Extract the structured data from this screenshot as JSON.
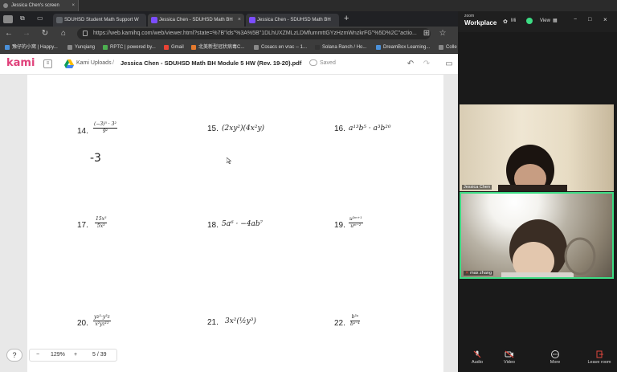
{
  "share_bar": {
    "title": "Jessica Chen's screen"
  },
  "browser": {
    "tabs": [
      {
        "label": "SDUHSD Student Math Support W"
      },
      {
        "label": "Jessica Chen - SDUHSD Math BH"
      },
      {
        "label": "Jessica Chen - SDUHSD Math BH"
      }
    ],
    "url": "https://web.kamihq.com/web/viewer.html?state=%7B\"ids\"%3A%5B\"1DLhUXZMLzLDMfummttGYzHzmWnzkrFG\"%5D%2C\"actio...",
    "bookmarks": [
      "豫仔的小窝 | Happy...",
      "Yunqiang",
      "RPTC | powered by...",
      "Gmail",
      "北美新型冠状病毒C...",
      "Cosacs en vrac -- 1...",
      "Solana Ranch / Ho...",
      "DreamBox Learning...",
      "Colle"
    ]
  },
  "kami": {
    "logo": "kami",
    "breadcrumb_root": "Kami Uploads",
    "breadcrumb_sep": "/",
    "filename": "Jessica Chen - SDUHSD Math BH Module 5 HW (Rev. 19-20).pdf",
    "saved_label": "Saved"
  },
  "document": {
    "handwritten": "-3",
    "problems": [
      {
        "num": "14.",
        "type": "frac",
        "n": "(−3)⁵ · 3²",
        "d": "9²"
      },
      {
        "num": "15.",
        "type": "expr",
        "text": "(2xy²)(4x²y)"
      },
      {
        "num": "16.",
        "type": "expr",
        "text": "a¹³b⁵ · a³b²⁰"
      },
      {
        "num": "17.",
        "type": "frac",
        "n": "15x⁵",
        "d": "5x³"
      },
      {
        "num": "18.",
        "type": "expr",
        "text": "5a⁶ · −4ab⁷"
      },
      {
        "num": "19.",
        "type": "frac",
        "n": "u²ᵐ⁺¹",
        "d": "uᵐ⁻²"
      },
      {
        "num": "20.",
        "type": "frac",
        "n": "yz²·y³z",
        "d": "x²yz¹²"
      },
      {
        "num": "21.",
        "type": "expr",
        "text": "3x²(½y³)"
      },
      {
        "num": "22.",
        "type": "frac",
        "n": "b³ᵃ",
        "d": "bᵃ⁻⁴"
      }
    ]
  },
  "viewer_controls": {
    "help": "?",
    "zoom_out": "−",
    "zoom_level": "129%",
    "zoom_in": "+",
    "page": "5 / 39"
  },
  "zoom_app": {
    "logo_small": "zoom",
    "logo_big": "Workplace",
    "header_items": [
      "Mi",
      "View"
    ],
    "participants": [
      {
        "name": "Jessica Chen"
      },
      {
        "name": "max zhang"
      }
    ],
    "footer": [
      {
        "label": "Audio"
      },
      {
        "label": "Video"
      },
      {
        "label": "More"
      },
      {
        "label": "Leave room"
      }
    ],
    "colors": {
      "active_speaker": "#3ddc84",
      "leave": "#e0463c",
      "kami_brand": "#e0407a"
    }
  }
}
